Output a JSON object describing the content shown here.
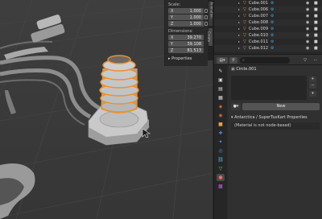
{
  "npanel": {
    "scale_label": "Scale:",
    "scale": [
      {
        "axis": "X",
        "value": "1.000"
      },
      {
        "axis": "Y",
        "value": "1.000"
      },
      {
        "axis": "Z",
        "value": "1.000"
      }
    ],
    "dimensions_label": "Dimensions:",
    "dimensions": [
      {
        "axis": "X",
        "value": "39.270"
      },
      {
        "axis": "Y",
        "value": "39.108"
      },
      {
        "axis": "Z",
        "value": "81.513"
      }
    ],
    "properties_label": "Properties",
    "tabs": [
      "Create",
      "Animation"
    ]
  },
  "outliner": {
    "items": [
      "Cube.001",
      "Cube.006",
      "Cube.007",
      "Cube.008",
      "Cube.009",
      "Cube.010",
      "Cube.011",
      "Cube.012"
    ]
  },
  "material": {
    "slot_name": "Circle.001",
    "new_label": "New",
    "section_title": "Antarctica / SuperTuxKart Properties",
    "note": "(Material is not node-based)"
  },
  "colors": {
    "selection_outline": "#e8922f",
    "viewport_bg": "#3c3c3c",
    "panel_bg": "#303030"
  }
}
